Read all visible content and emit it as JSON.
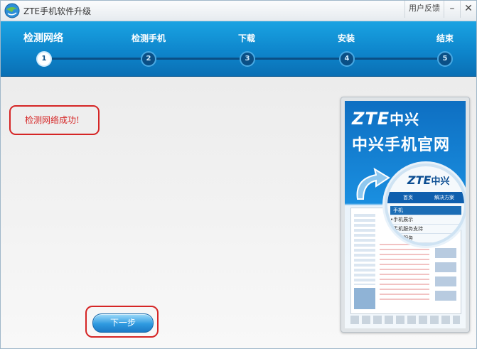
{
  "window": {
    "title": "ZTE手机软件升级",
    "feedback_label": "用户反馈",
    "minimize_label": "–",
    "close_label": "✕"
  },
  "steps": [
    {
      "number": "1",
      "label": "检测网络",
      "active": true
    },
    {
      "number": "2",
      "label": "检测手机",
      "active": false
    },
    {
      "number": "3",
      "label": "下载",
      "active": false
    },
    {
      "number": "4",
      "label": "安装",
      "active": false
    },
    {
      "number": "5",
      "label": "结束",
      "active": false
    }
  ],
  "main": {
    "status_text": "检测网络成功!",
    "next_button_label": "下一步"
  },
  "ad": {
    "logo_latin": "ZTE",
    "logo_cn": "中兴",
    "slogan": "中兴手机官网",
    "nav_home": "首页",
    "nav_solutions": "解决方案",
    "menu_header": "手机",
    "menu_items": [
      "•手机展示",
      "•手机服务支持",
      "•维心服务"
    ]
  },
  "colors": {
    "accent_blue": "#0e86cc",
    "highlight_red": "#d52525"
  }
}
